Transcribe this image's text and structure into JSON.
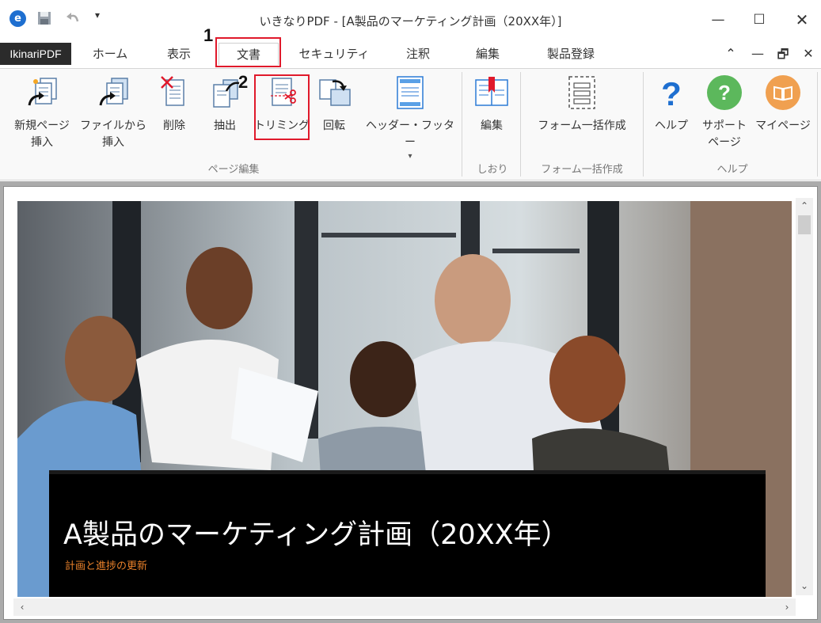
{
  "window": {
    "title": "いきなりPDF - [A製品のマーケティング計画（20XX年）]",
    "app_logo": "e",
    "qa_more": "▾",
    "minimize": "—",
    "maximize": "☐",
    "close": "✕"
  },
  "tabs": {
    "file": "IkinariPDF",
    "items": [
      "ホーム",
      "表示",
      "文書",
      "セキュリティ",
      "注釈",
      "編集",
      "製品登録"
    ],
    "active": "文書",
    "controls": [
      "⌃",
      "—",
      "🗗",
      "✕"
    ]
  },
  "callouts": {
    "one": "1",
    "two": "2"
  },
  "ribbon": {
    "page_edit": {
      "label": "ページ編集",
      "buttons": {
        "new_page": [
          "新規ページ",
          "挿入"
        ],
        "from_file": [
          "ファイルから",
          "挿入"
        ],
        "delete": "削除",
        "extract": "抽出",
        "trimming": "トリミング",
        "rotate": "回転",
        "header_footer": "ヘッダー・フッター",
        "header_footer_arrow": "▾"
      }
    },
    "bookmark": {
      "label": "しおり",
      "edit": "編集"
    },
    "form": {
      "label": "フォーム一括作成",
      "button": "フォーム一括作成"
    },
    "help": {
      "label": "ヘルプ",
      "help": "ヘルプ",
      "support": [
        "サポート",
        "ページ"
      ],
      "mypage": "マイページ"
    }
  },
  "document": {
    "title": "A製品のマーケティング計画（20XX年）",
    "subtitle": "計画と進捗の更新"
  },
  "scrollbar": {
    "up": "⌃",
    "down": "⌄",
    "left": "‹",
    "right": "›"
  },
  "colors": {
    "callout": "#e0192b",
    "accent_orange": "#e8802a",
    "help_blue": "#1e6fd0",
    "support_green": "#5cb85c",
    "mypage_orange": "#f0a050"
  }
}
